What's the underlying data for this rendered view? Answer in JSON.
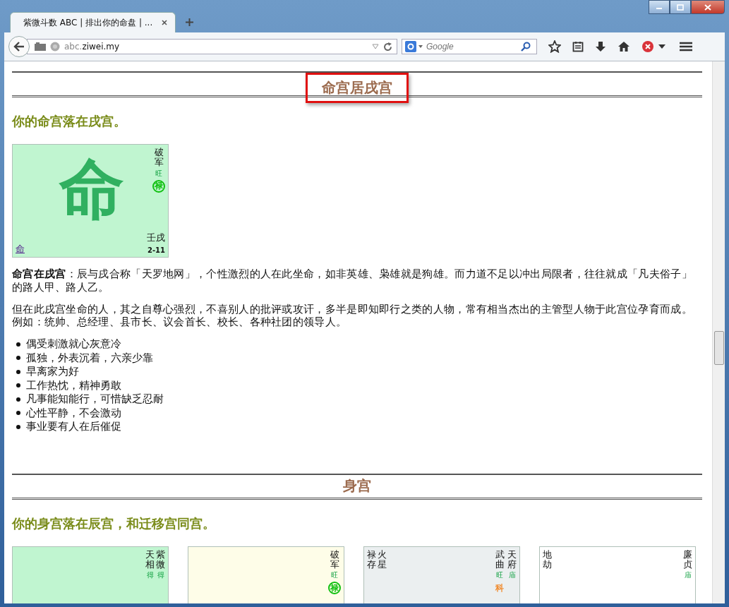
{
  "browser": {
    "tab_title": "紫微斗数 ABC | 排出你的命盘 | ...",
    "url_host": "abc.",
    "url_domain": "ziwei.my",
    "search_placeholder": "Google"
  },
  "sections": [
    {
      "heading": "命宫居戌宫",
      "highlighted": true,
      "subtitle": "你的命宫落在戌宫。",
      "palaces": [
        {
          "color": "#c0f5d0",
          "big_char": "命",
          "branch": "壬戌",
          "age": "2-11",
          "name": "命",
          "right_stars": [
            {
              "name": "破军",
              "brightness": "旺",
              "transform": {
                "label": "禄",
                "color": "#10c010",
                "circled": true
              }
            }
          ]
        }
      ],
      "paragraphs": [
        "**命宫在戌宫**：辰与戌合称「天罗地网」，个性激烈的人在此坐命，如非英雄、枭雄就是狗雄。而力道不足以冲出局限者，往往就成「凡夫俗子」的路人甲、路人乙。",
        "但在此戌宫坐命的人，其之自尊心强烈，不喜别人的批评或攻讦，多半是即知即行之类的人物，常有相当杰出的主管型人物于此宫位孕育而成。例如：统帅、总经理、县市长、议会首长、校长、各种社团的领导人。"
      ],
      "bullets": [
        "偶受刺激就心灰意冷",
        "孤独，外表沉着，六亲少靠",
        "早离家为好",
        "工作热忱，精神勇敢",
        "凡事能知能行，可惜缺乏忍耐",
        "心性平静，不会激动",
        "事业要有人在后催促"
      ]
    },
    {
      "heading": "身宫",
      "highlighted": false,
      "subtitle": "你的身宫落在辰宫，和迁移宫同宫。",
      "palaces": [
        {
          "color": "#c0f5d0",
          "right_stars": [
            {
              "name": "天相",
              "brightness": "得"
            },
            {
              "name": "紫微",
              "brightness": "得"
            }
          ]
        },
        {
          "color": "#fefde8",
          "right_stars": [
            {
              "name": "破军",
              "brightness": "旺",
              "transform": {
                "label": "禄",
                "color": "#10c010",
                "circled": true
              }
            }
          ]
        },
        {
          "color": "#ebeff0",
          "left_stars": [
            {
              "name": "禄存"
            },
            {
              "name": "火星"
            }
          ],
          "right_stars": [
            {
              "name": "武曲",
              "brightness": "旺",
              "transform": {
                "label": "科",
                "color": "#f08c30",
                "circled": false
              }
            },
            {
              "name": "天府",
              "brightness": "庙"
            }
          ]
        },
        {
          "color": "#ffffff",
          "left_stars": [
            {
              "name": "地劫"
            }
          ],
          "right_stars": [
            {
              "name": "廉贞",
              "brightness": "庙"
            }
          ]
        }
      ]
    }
  ]
}
